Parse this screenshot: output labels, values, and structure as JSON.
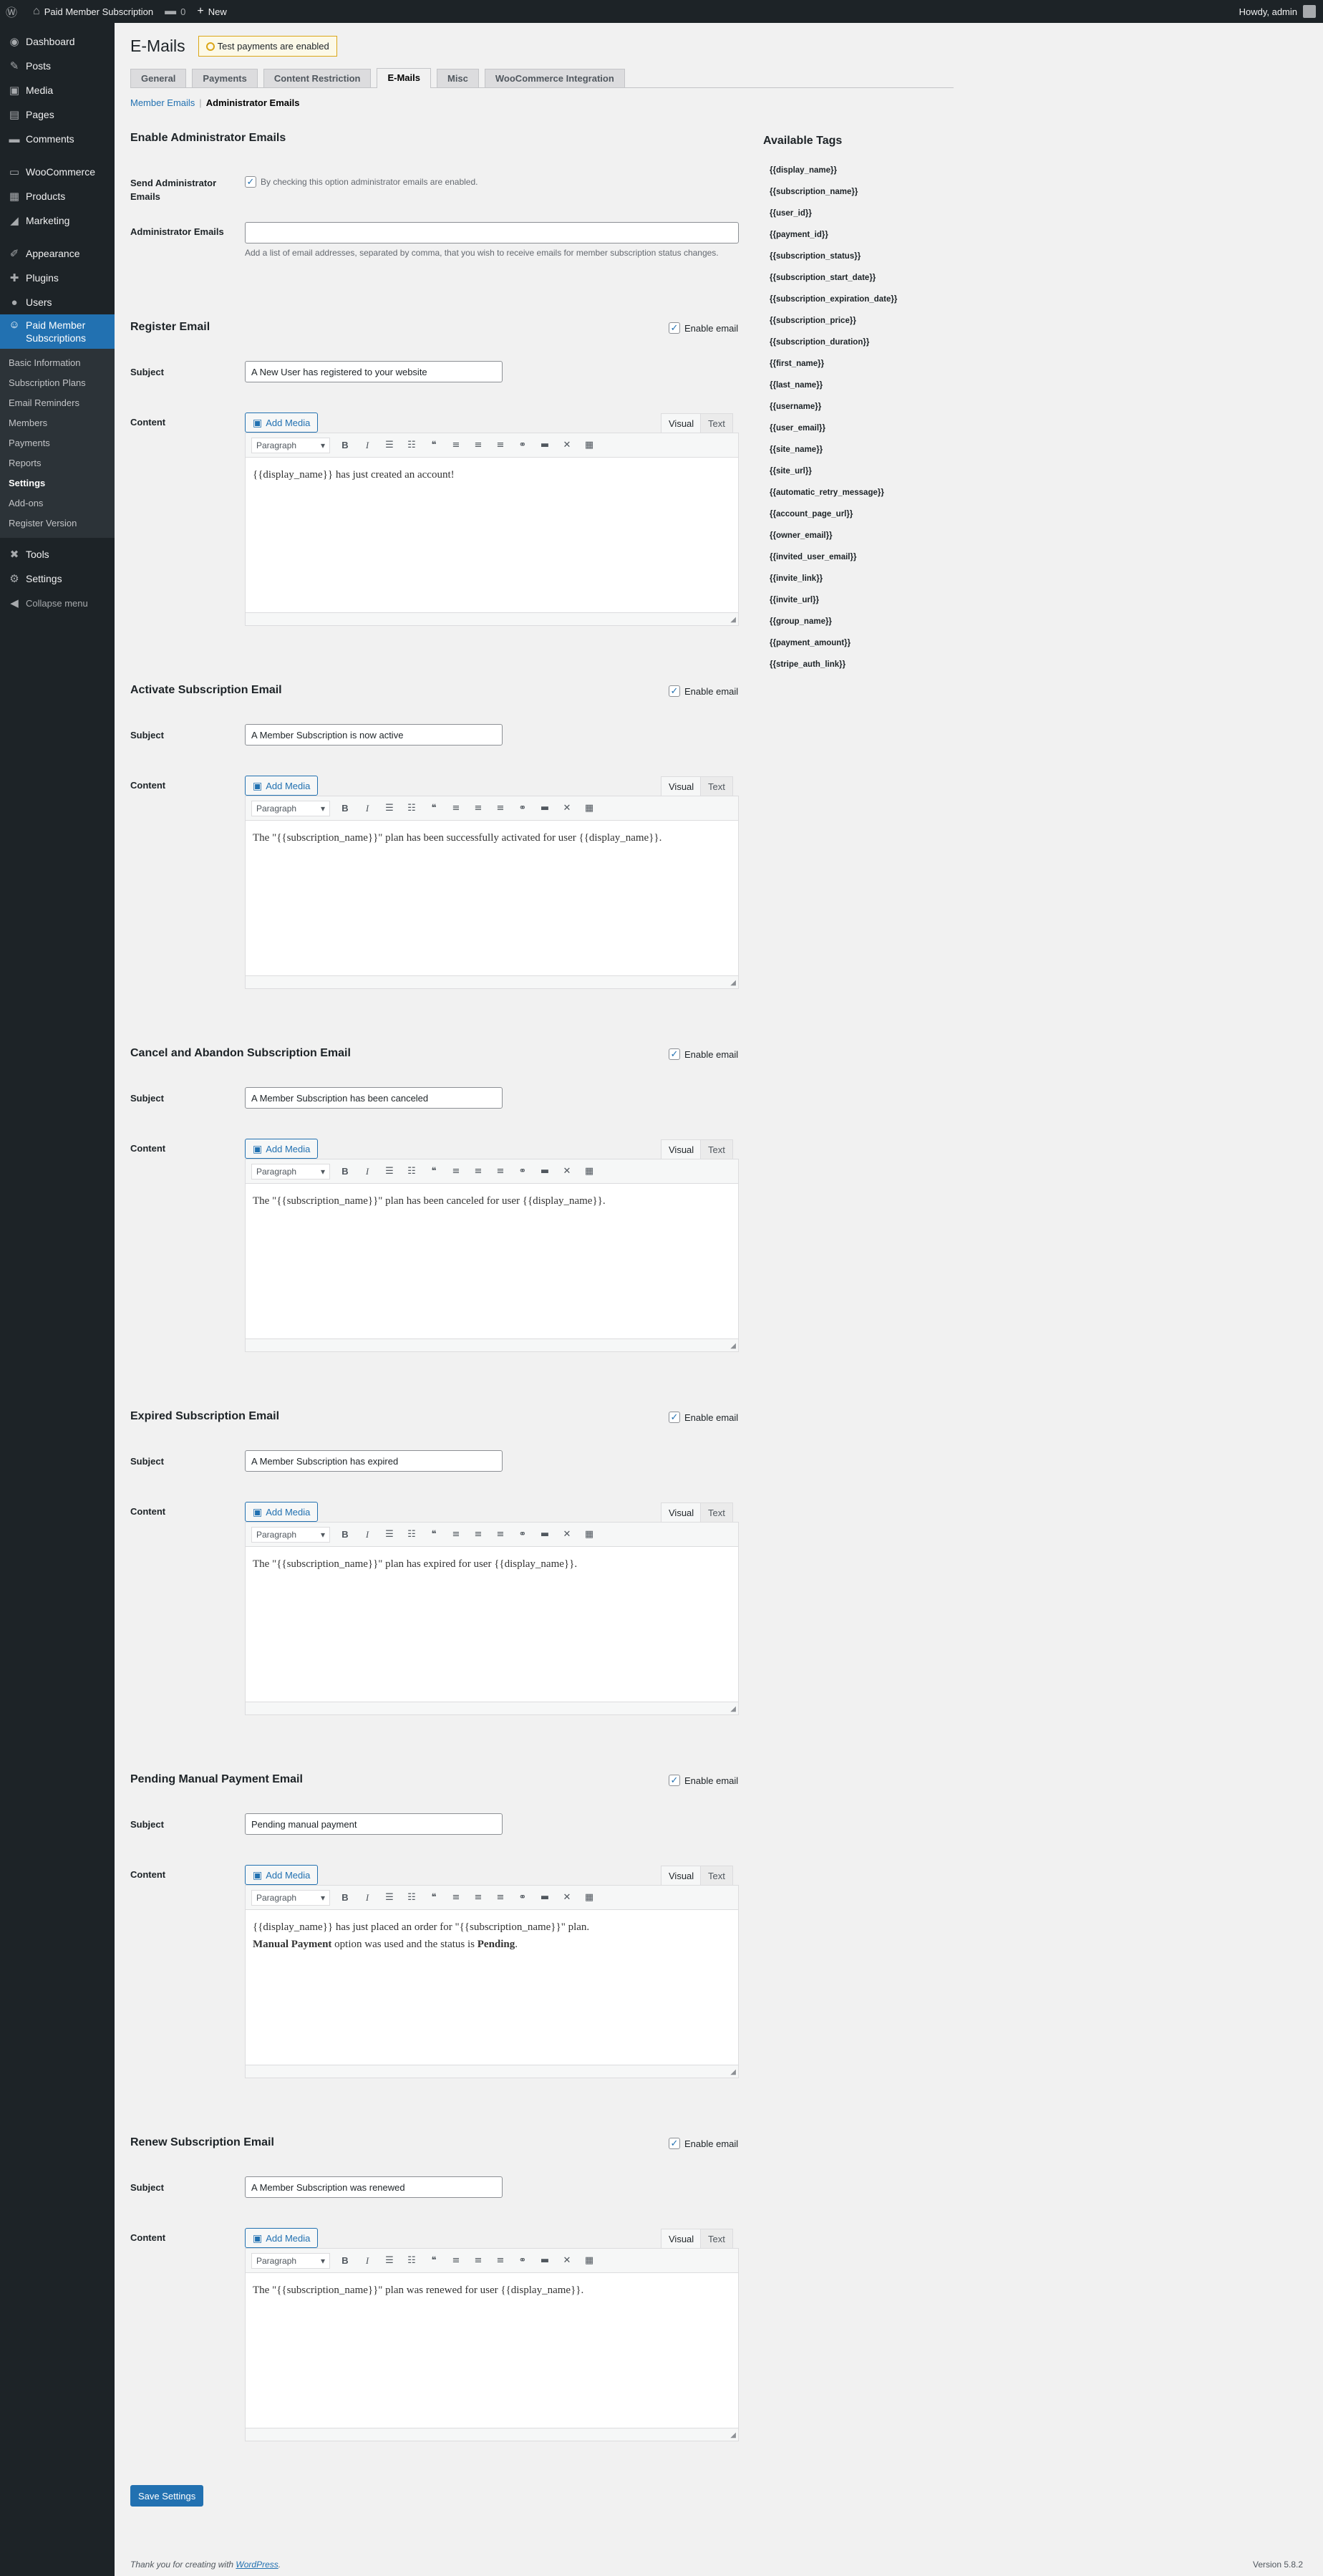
{
  "adminbar": {
    "wp_logo_icon": "wordpress-icon",
    "site_name": "Paid Member Subscription",
    "comments_count": "0",
    "new_label": "New",
    "greeting": "Howdy, admin"
  },
  "sidebar": {
    "items_top": [
      {
        "label": "Dashboard",
        "icon": "dashboard-icon",
        "glyph": "◉"
      },
      {
        "label": "Posts",
        "icon": "pin-icon",
        "glyph": "✎"
      },
      {
        "label": "Media",
        "icon": "media-icon",
        "glyph": "▣"
      },
      {
        "label": "Pages",
        "icon": "page-icon",
        "glyph": "▤"
      },
      {
        "label": "Comments",
        "icon": "comment-icon",
        "glyph": "▬"
      },
      {
        "label": "WooCommerce",
        "icon": "woocommerce-icon",
        "glyph": "▭"
      },
      {
        "label": "Products",
        "icon": "products-icon",
        "glyph": "▦"
      },
      {
        "label": "Marketing",
        "icon": "megaphone-icon",
        "glyph": "◢"
      },
      {
        "label": "Appearance",
        "icon": "brush-icon",
        "glyph": "✐"
      },
      {
        "label": "Plugins",
        "icon": "plugin-icon",
        "glyph": "✚"
      },
      {
        "label": "Users",
        "icon": "users-icon",
        "glyph": "●"
      }
    ],
    "current_item": {
      "label_line1": "Paid Member",
      "label_line2": "Subscriptions",
      "icon": "member-icon",
      "glyph": "☺"
    },
    "submenu": [
      "Basic Information",
      "Subscription Plans",
      "Email Reminders",
      "Members",
      "Payments",
      "Reports",
      "Settings",
      "Add-ons",
      "Register Version"
    ],
    "submenu_current": "Settings",
    "items_bottom": [
      {
        "label": "Tools",
        "icon": "tools-icon",
        "glyph": "✖"
      },
      {
        "label": "Settings",
        "icon": "settings-icon",
        "glyph": "⚙"
      }
    ],
    "collapse_label": "Collapse menu"
  },
  "header": {
    "title": "E-Mails",
    "notice": "Test payments are enabled"
  },
  "tabs": [
    "General",
    "Payments",
    "Content Restriction",
    "E-Mails",
    "Misc",
    "WooCommerce Integration"
  ],
  "active_tab": "E-Mails",
  "subnav": {
    "member_emails": "Member Emails",
    "separator": "|",
    "admin_emails": "Administrator Emails"
  },
  "admin_section": {
    "title": "Enable Administrator Emails",
    "send_label": "Send Administrator Emails",
    "send_checkbox_text": "By checking this option administrator emails are enabled.",
    "emails_label": "Administrator Emails",
    "emails_value": "",
    "emails_desc": "Add a list of email addresses, separated by comma, that you wish to receive emails for member subscription status changes."
  },
  "labels": {
    "subject": "Subject",
    "content": "Content",
    "enable_email": "Enable email",
    "add_media": "Add Media",
    "visual": "Visual",
    "text": "Text",
    "paragraph": "Paragraph"
  },
  "emails": [
    {
      "title": "Register Email",
      "subject": "A New User has registered to your website",
      "content_lines": [
        "{{display_name}} has just created an account!"
      ]
    },
    {
      "title": "Activate Subscription Email",
      "subject": "A Member Subscription is now active",
      "content_lines": [
        "The \"{{subscription_name}}\" plan has been successfully activated for user {{display_name}}."
      ]
    },
    {
      "title": "Cancel and Abandon Subscription Email",
      "subject": "A Member Subscription has been canceled",
      "content_lines": [
        "The \"{{subscription_name}}\" plan has been canceled for user {{display_name}}."
      ]
    },
    {
      "title": "Expired Subscription Email",
      "subject": "A Member Subscription has expired",
      "content_lines": [
        "The \"{{subscription_name}}\" plan has expired for user {{display_name}}."
      ]
    },
    {
      "title": "Pending Manual Payment Email",
      "subject": "Pending manual payment",
      "content_lines": [
        "{{display_name}} has just placed an order for \"{{subscription_name}}\" plan."
      ],
      "content_rich": {
        "b1": "Manual Payment",
        "mid": " option was used and the status is ",
        "b2": "Pending",
        "end": "."
      }
    },
    {
      "title": "Renew Subscription Email",
      "subject": "A Member Subscription was renewed",
      "content_lines": [
        "The \"{{subscription_name}}\" plan was renewed for user {{display_name}}."
      ]
    }
  ],
  "tags_panel": {
    "title": "Available Tags",
    "tags": [
      "{{display_name}}",
      "{{subscription_name}}",
      "{{user_id}}",
      "{{payment_id}}",
      "{{subscription_status}}",
      "{{subscription_start_date}}",
      "{{subscription_expiration_date}}",
      "{{subscription_price}}",
      "{{subscription_duration}}",
      "{{first_name}}",
      "{{last_name}}",
      "{{username}}",
      "{{user_email}}",
      "{{site_name}}",
      "{{site_url}}",
      "{{automatic_retry_message}}",
      "{{account_page_url}}",
      "{{owner_email}}",
      "{{invited_user_email}}",
      "{{invite_link}}",
      "{{invite_url}}",
      "{{group_name}}",
      "{{payment_amount}}",
      "{{stripe_auth_link}}"
    ]
  },
  "save_button": "Save Settings",
  "footer": {
    "thanks_prefix": "Thank you for creating with ",
    "wordpress_link": "WordPress",
    "thanks_suffix": ".",
    "version": "Version 5.8.2"
  },
  "colors": {
    "accent": "#2271b1",
    "sidebar_bg": "#1d2327",
    "notice_border": "#dba617"
  }
}
